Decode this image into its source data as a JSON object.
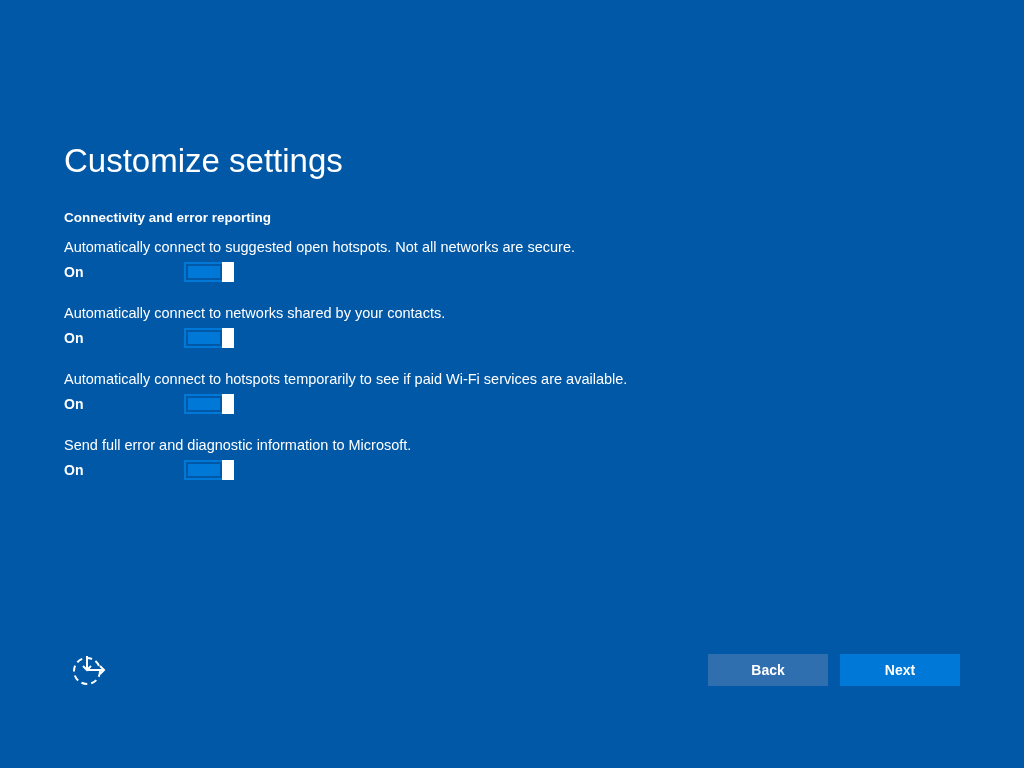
{
  "title": "Customize settings",
  "section": {
    "heading": "Connectivity and error reporting",
    "settings": [
      {
        "description": "Automatically connect to suggested open hotspots. Not all networks are secure.",
        "state_label": "On",
        "on": true
      },
      {
        "description": "Automatically connect to networks shared by your contacts.",
        "state_label": "On",
        "on": true
      },
      {
        "description": "Automatically connect to hotspots temporarily to see if paid Wi-Fi services are available.",
        "state_label": "On",
        "on": true
      },
      {
        "description": "Send full error and diagnostic information to Microsoft.",
        "state_label": "On",
        "on": true
      }
    ]
  },
  "buttons": [
    {
      "label": "Back",
      "kind": "secondary"
    },
    {
      "label": "Next",
      "kind": "primary"
    }
  ]
}
